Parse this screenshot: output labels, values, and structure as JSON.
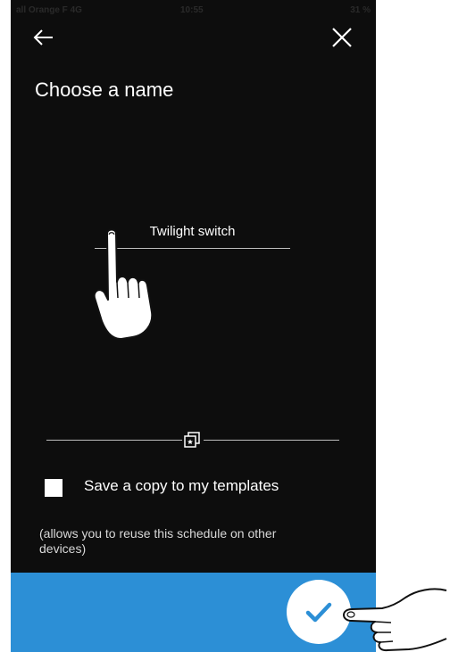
{
  "status_bar": {
    "carrier": "all Orange F 4G",
    "time": "10:55",
    "battery": "31 %"
  },
  "header": {
    "back_icon": "arrow-left-icon",
    "close_icon": "close-icon",
    "title": "Choose a name"
  },
  "name_input": {
    "value": "Twilight switch"
  },
  "slider": {
    "handle_icon": "copy-star-icon"
  },
  "template_option": {
    "checked": false,
    "label": "Save a copy to my templates",
    "hint": "(allows you to reuse this schedule on other devices)"
  },
  "footer": {
    "confirm_icon": "checkmark-icon"
  },
  "colors": {
    "background": "#0d0d0d",
    "footer": "#2c8fd6",
    "confirm_button": "#ffffff",
    "check": "#2c8fd6"
  }
}
